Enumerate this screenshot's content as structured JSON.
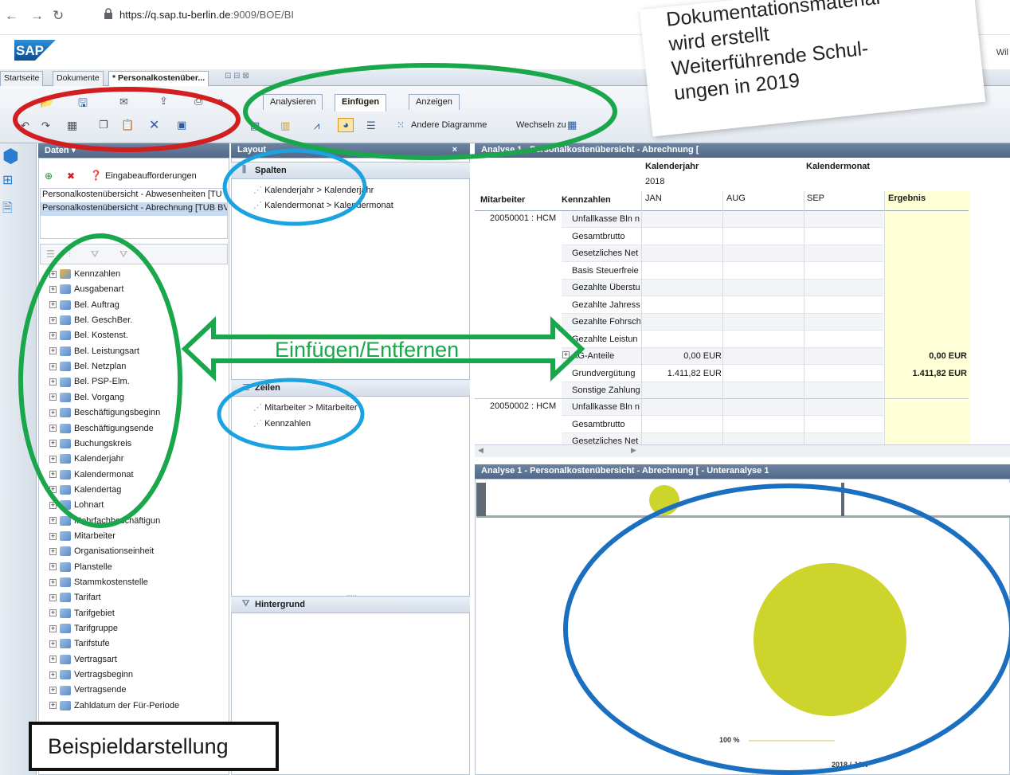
{
  "browser": {
    "url_prefix": "https://q.sap.tu-berlin.de",
    "url_rest": ":9009/BOE/BI"
  },
  "header": {
    "logo": "SAP",
    "user": "Wil"
  },
  "doc_tabs": [
    "Startseite",
    "Dokumente",
    "* Personalkostenüber..."
  ],
  "ribbon_tabs": [
    "Analysieren",
    "Einfügen",
    "Anzeigen"
  ],
  "ribbon_actions": {
    "other_charts": "Andere Diagramme",
    "switch_to": "Wechseln zu"
  },
  "data_panel": {
    "title": "Daten",
    "prompts": "Eingabeaufforderungen",
    "sources": [
      "Personalkostenübersicht - Abwesenheiten [TU",
      "Personalkostenübersicht - Abrechnung [TUB BV"
    ],
    "tree": [
      "Kennzahlen",
      "Ausgabenart",
      "Bel. Auftrag",
      "Bel. GeschBer.",
      "Bel. Kostenst.",
      "Bel. Leistungsart",
      "Bel. Netzplan",
      "Bel. PSP-Elm.",
      "Bel. Vorgang",
      "Beschäftigungsbeginn",
      "Beschäftigungsende",
      "Buchungskreis",
      "Kalenderjahr",
      "Kalendermonat",
      "Kalendertag",
      "Lohnart",
      "Mehrfachbeschäftigun",
      "Mitarbeiter",
      "Organisationseinheit",
      "Planstelle",
      "Stammkostenstelle",
      "Tarifart",
      "Tarifgebiet",
      "Tarifgruppe",
      "Tarifstufe",
      "Vertragsart",
      "Vertragsbeginn",
      "Vertragsende",
      "Zahldatum der Für-Periode"
    ]
  },
  "layout_panel": {
    "title": "Layout",
    "columns_label": "Spalten",
    "columns": [
      "Kalenderjahr > Kalenderjahr",
      "Kalendermonat > Kalendermonat"
    ],
    "rows_label": "Zeilen",
    "rows": [
      "Mitarbeiter > Mitarbeiter",
      "Kennzahlen"
    ],
    "background_label": "Hintergrund"
  },
  "analysis": {
    "title": "Analyse 1 - Personalkostenübersicht - Abrechnung [",
    "col_dim1": "Kalenderjahr",
    "col_dim2": "Kalendermonat",
    "year": "2018",
    "row_hdr1": "Mitarbeiter",
    "row_hdr2": "Kennzahlen",
    "months": [
      "JAN",
      "AUG",
      "SEP"
    ],
    "result": "Ergebnis",
    "employee1": "20050001 : HCM",
    "employee2": "20050002 : HCM",
    "rows1": [
      {
        "label": "Unfallkasse Bln n",
        "jan": "",
        "res": ""
      },
      {
        "label": "Gesamtbrutto",
        "jan": "",
        "res": ""
      },
      {
        "label": "Gesetzliches Net",
        "jan": "",
        "res": ""
      },
      {
        "label": "Basis Steuerfreie",
        "jan": "",
        "res": ""
      },
      {
        "label": "Gezahlte Überstu",
        "jan": "",
        "res": ""
      },
      {
        "label": "Gezahlte Jahress",
        "jan": "",
        "res": ""
      },
      {
        "label": "Gezahlte Fohrsch",
        "jan": "",
        "res": ""
      },
      {
        "label": "Gezahlte Leistun",
        "jan": "",
        "res": ""
      },
      {
        "label": "AG-Anteile",
        "jan": "0,00 EUR",
        "res": "0,00 EUR"
      },
      {
        "label": "Grundvergütung",
        "jan": "1.411,82 EUR",
        "res": "1.411,82 EUR"
      },
      {
        "label": "Sonstige Zahlung",
        "jan": "",
        "res": ""
      }
    ],
    "rows2": [
      {
        "label": "Unfallkasse Bln n"
      },
      {
        "label": "Gesamtbrutto"
      },
      {
        "label": "Gesetzliches Net"
      }
    ]
  },
  "subanalysis": {
    "title": "Analyse 1 - Personalkostenübersicht - Abrechnung [ - Unteranalyse 1",
    "pie_label": "100 %",
    "pie_category": "2018 / JAN"
  },
  "chart_data": {
    "type": "pie",
    "categories": [
      "2018 / JAN"
    ],
    "values": [
      100
    ],
    "labels": [
      "100 %"
    ]
  },
  "annotations": {
    "note_lines": [
      "Dokumentationsmaterial",
      "wird erstellt",
      "Weiterführende Schul-",
      "ungen in 2019"
    ],
    "arrow_label": "Einfügen/Entfernen",
    "example_label": "Beispieldarstellung",
    "colors": {
      "red": "#d11f1f",
      "green": "#1aa64a",
      "light_blue": "#1aa3e0",
      "blue": "#1a6fc0",
      "black": "#111111"
    }
  },
  "colors": {
    "pie": "#cdd42b",
    "result_col": "#ffffd8",
    "pane_header": "#5d7594"
  }
}
